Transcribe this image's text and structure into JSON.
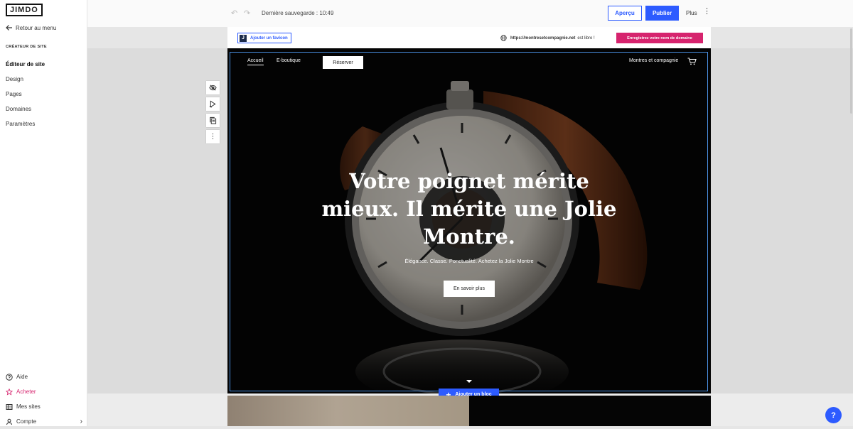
{
  "sidebar": {
    "logo": "JIMDO",
    "back_label": "Retour au menu",
    "section_label": "CRÉATEUR DE SITE",
    "items": [
      {
        "label": "Éditeur de site"
      },
      {
        "label": "Design"
      },
      {
        "label": "Pages"
      },
      {
        "label": "Domaines"
      },
      {
        "label": "Paramètres"
      }
    ],
    "bottom": {
      "help": "Aide",
      "buy": "Acheter",
      "sites": "Mes sites",
      "account": "Compte"
    }
  },
  "topbar": {
    "save_status": "Dernière sauvegarde : 10:49",
    "preview_label": "Aperçu",
    "publish_label": "Publier",
    "more_label": "Plus"
  },
  "browser": {
    "favicon_letter": "J",
    "favicon_label": "Ajouter un favicon",
    "domain": "https://montresetcompagnie.net",
    "domain_status": "est libre !",
    "register_label": "Enregistrez votre nom de domaine"
  },
  "hero": {
    "nav": {
      "home": "Accueil",
      "shop": "E-boutique",
      "book": "Réserver",
      "brand": "Montres et compagnie"
    },
    "title_lines": [
      "Votre poignet mérite",
      "mieux. Il mérite une Jolie",
      "Montre."
    ],
    "subtitle": "Élégance. Classe. Ponctualité. Achetez la Jolie Montre",
    "cta": "En savoir plus"
  },
  "add_block_label": "Ajouter un bloc",
  "help_label": "?",
  "colors": {
    "accent_blue": "#2d5bff",
    "accent_pink": "#d6246e"
  }
}
